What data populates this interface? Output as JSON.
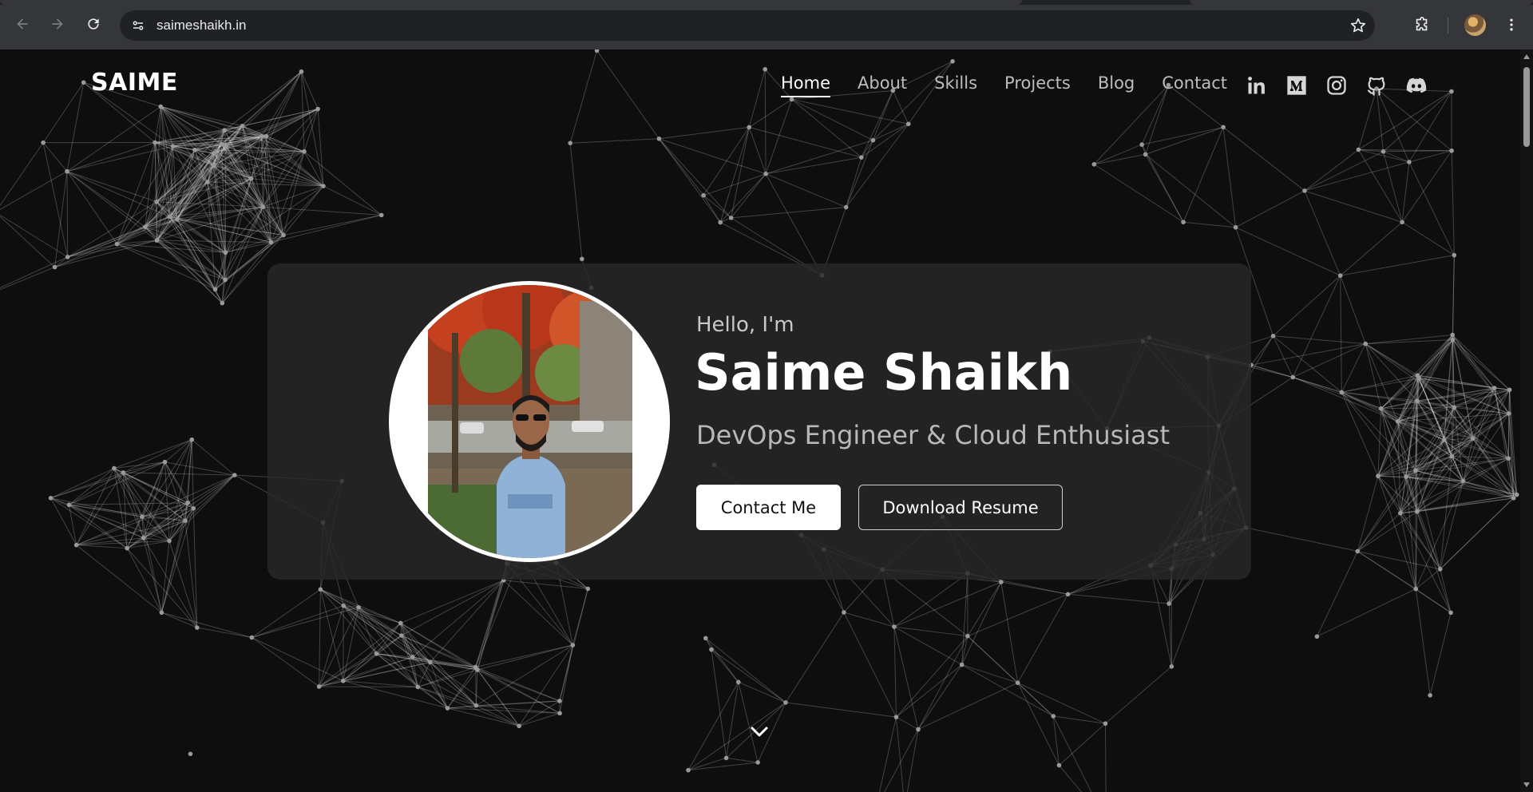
{
  "browser": {
    "url": "saimeshaikh.in",
    "icons": {
      "back": "arrow-left-icon",
      "forward": "arrow-right-icon",
      "reload": "reload-icon",
      "site_info": "site-settings-icon",
      "bookmark": "star-icon",
      "extensions": "puzzle-icon",
      "menu": "kebab-menu-icon"
    }
  },
  "header": {
    "logo": "SAIME",
    "nav": [
      "Home",
      "About",
      "Skills",
      "Projects",
      "Blog",
      "Contact"
    ],
    "active_nav": "Home",
    "social": [
      "linkedin-icon",
      "medium-icon",
      "instagram-icon",
      "github-icon",
      "discord-icon"
    ]
  },
  "hero": {
    "greeting": "Hello, I'm",
    "name": "Saime Shaikh",
    "tagline": "DevOps Engineer & Cloud Enthusiast",
    "primary_button": "Contact Me",
    "secondary_button": "Download Resume",
    "scroll_icon": "chevron-down-icon"
  },
  "colors": {
    "background": "#0e0e0e",
    "card": "#282828",
    "accent": "#ffffff"
  }
}
